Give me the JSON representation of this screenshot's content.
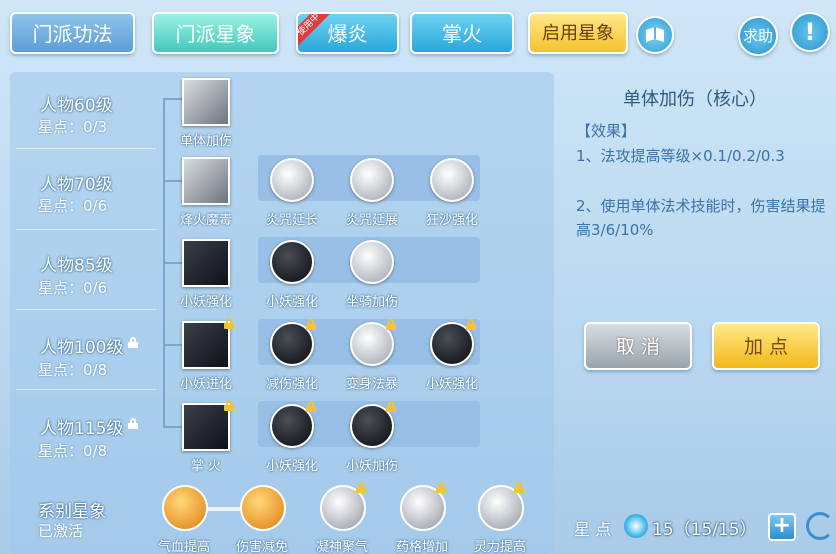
{
  "tabs": [
    {
      "label": "门派功法"
    },
    {
      "label": "门派星象"
    },
    {
      "label": "爆炎",
      "badge": "使用中"
    },
    {
      "label": "掌火"
    },
    {
      "label": "启用星象"
    }
  ],
  "top_buttons": {
    "help": "求助",
    "info": "!"
  },
  "levels": [
    {
      "name": "人物60级",
      "stars": "星点：0/3",
      "locked": false
    },
    {
      "name": "人物70级",
      "stars": "星点：0/6",
      "locked": false
    },
    {
      "name": "人物85级",
      "stars": "星点：0/6",
      "locked": false
    },
    {
      "name": "人物100级",
      "stars": "星点：0/8",
      "locked": true
    },
    {
      "name": "人物115级",
      "stars": "星点：0/8",
      "locked": true
    }
  ],
  "skills": {
    "r1": [
      "单体加伤"
    ],
    "r2": [
      "烽火魔毒",
      "炎咒延长",
      "炎咒延展",
      "狂沙强化"
    ],
    "r3": [
      "小妖强化",
      "小妖强化",
      "坐骑加伤"
    ],
    "r4": [
      "小妖进化",
      "减伤强化",
      "变身法暴",
      "小妖强化"
    ],
    "r5": [
      "掌 火",
      "小妖强化",
      "小妖加伤"
    ]
  },
  "series": {
    "title": "系别星象",
    "status": "已激活",
    "items": [
      "气血提高",
      "伤害减免",
      "凝神聚气",
      "药格增加",
      "灵力提高"
    ]
  },
  "detail": {
    "title": "单体加伤（核心）",
    "effect_head": "【效果】",
    "line1": "1、法攻提高等级×0.1/0.2/0.3",
    "line2": "2、使用单体法术技能时，伤害结果提高3/6/10%"
  },
  "buttons": {
    "cancel": "取 消",
    "add": "加 点"
  },
  "star_points": {
    "label": "星 点",
    "value": "15（15/15）"
  }
}
